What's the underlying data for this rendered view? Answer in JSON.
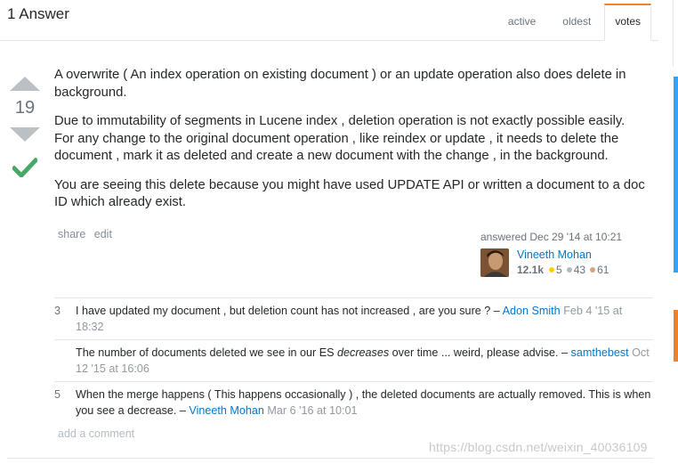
{
  "header": {
    "title": "1 Answer",
    "tabs": [
      {
        "label": "active"
      },
      {
        "label": "oldest"
      },
      {
        "label": "votes",
        "selected": true
      }
    ]
  },
  "answer": {
    "vote_count": "19",
    "accepted": true,
    "paragraphs": [
      "A overwrite ( An index operation on existing document ) or an update operation also does delete in background.",
      "Due to immutability of segments in Lucene index , deletion operation is not exactly possible easily. For any change to the original document operation , like reindex or update , it needs to delete the document , mark it as deleted and create a new document with the change , in the background.",
      "You are seeing this delete because you might have used UPDATE API or written a document to a doc ID which already exist."
    ],
    "menu": {
      "share": "share",
      "edit": "edit"
    },
    "author": {
      "action_time": "answered Dec 29 '14 at 10:21",
      "name": "Vineeth Mohan",
      "reputation": "12.1k",
      "gold": "5",
      "silver": "43",
      "bronze": "61"
    }
  },
  "comments": [
    {
      "score": "3",
      "text": "I have updated my document , but deletion count has not increased , are you sure ? – ",
      "user": "Adon Smith",
      "date": "Feb 4 '15 at 18:32"
    },
    {
      "score": "",
      "text_before": "The number of documents deleted we see in our ES ",
      "emph": "decreases",
      "text_after": " over time ... weird, please advise. – ",
      "user": "samthebest",
      "date": "Oct 12 '15 at 16:06"
    },
    {
      "score": "5",
      "text": "When the merge happens ( This happens occasionally ) , the deleted documents are actually removed. This is when you see a decrease. – ",
      "user": "Vineeth Mohan",
      "date": "Mar 6 '16 at 10:01"
    }
  ],
  "add_comment": "add a comment",
  "watermark": "https://blog.csdn.net/weixin_40036109",
  "colors": {
    "link": "#0077cc",
    "accepted": "#48a868",
    "active_tab": "#f48024",
    "gold": "#ffcc01",
    "silver": "#b4b8bc",
    "bronze": "#d1a684"
  }
}
